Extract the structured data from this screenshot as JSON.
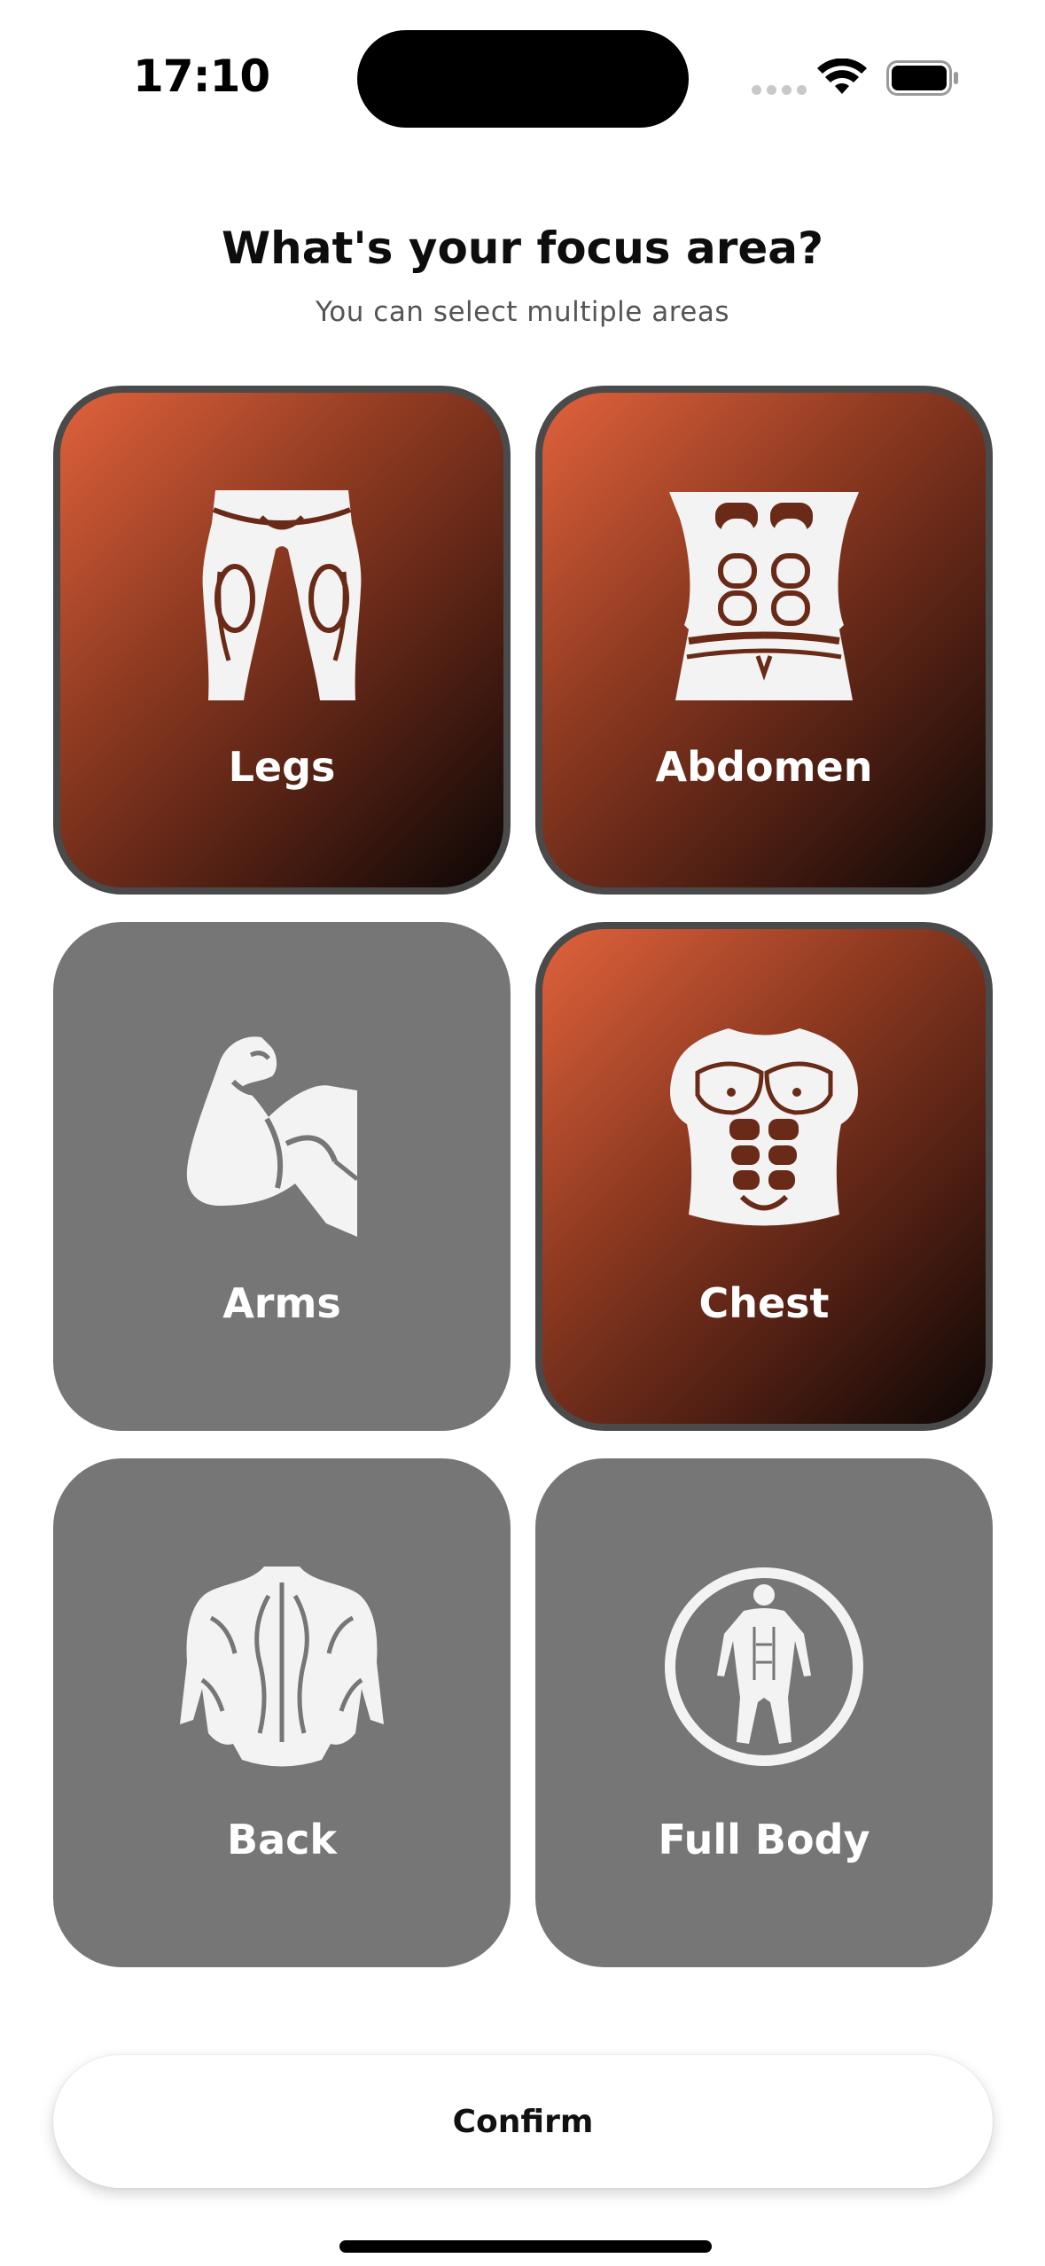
{
  "status_bar": {
    "time": "17:10"
  },
  "header": {
    "title": "What's your focus area?",
    "subtitle": "You can select multiple areas"
  },
  "focus_areas": [
    {
      "label": "Legs",
      "icon": "legs-icon",
      "selected": true
    },
    {
      "label": "Abdomen",
      "icon": "abdomen-icon",
      "selected": true
    },
    {
      "label": "Arms",
      "icon": "flexed-arm-icon",
      "selected": false
    },
    {
      "label": "Chest",
      "icon": "chest-torso-icon",
      "selected": true
    },
    {
      "label": "Back",
      "icon": "back-muscles-icon",
      "selected": false
    },
    {
      "label": "Full Body",
      "icon": "full-body-icon",
      "selected": false
    }
  ],
  "footer": {
    "confirm_label": "Confirm"
  },
  "colors": {
    "selected_gradient_start": "#e0623c",
    "selected_gradient_end": "#0b0605",
    "unselected_card": "#767676",
    "selected_border": "#4a4a4a"
  }
}
